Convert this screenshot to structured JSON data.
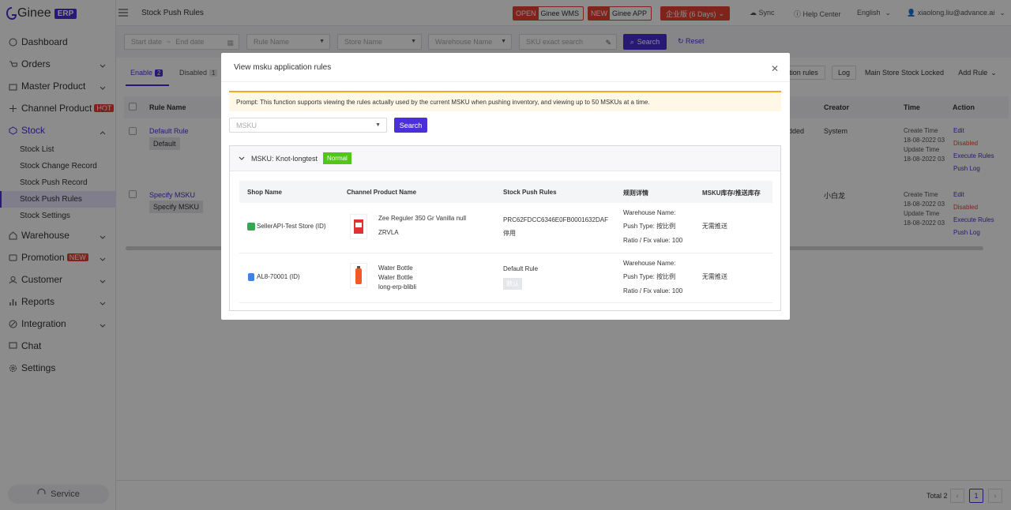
{
  "app": {
    "brand": "Ginee",
    "brand_tag": "ERP",
    "page_title": "Stock Push Rules"
  },
  "sidebar": {
    "items": [
      {
        "label": "Dashboard",
        "icon": "dashboard-icon"
      },
      {
        "label": "Orders",
        "icon": "cart-icon"
      },
      {
        "label": "Master Product",
        "icon": "bag-icon"
      },
      {
        "label": "Channel Product",
        "icon": "channel-icon",
        "badge": "HOT"
      },
      {
        "label": "Stock",
        "icon": "stock-icon"
      },
      {
        "label": "Warehouse",
        "icon": "warehouse-icon"
      },
      {
        "label": "Promotion",
        "icon": "promotion-icon",
        "badge": "NEW"
      },
      {
        "label": "Customer",
        "icon": "customer-icon"
      },
      {
        "label": "Reports",
        "icon": "reports-icon"
      },
      {
        "label": "Integration",
        "icon": "integration-icon"
      },
      {
        "label": "Chat",
        "icon": "chat-icon"
      },
      {
        "label": "Settings",
        "icon": "settings-icon"
      }
    ],
    "stock_sub": [
      "Stock List",
      "Stock Change Record",
      "Stock Push Record",
      "Stock Push Rules",
      "Stock Settings"
    ],
    "service": "Service"
  },
  "topbar": {
    "wms_tag": "OPEN",
    "wms_label": "Ginee WMS",
    "app_tag": "NEW",
    "app_label": "Ginee APP",
    "vip_label": "企业版 (6 Days)",
    "sync": "Sync",
    "help": "Help Center",
    "lang": "English",
    "user": "xiaolong.liu@advance.ai"
  },
  "filters": {
    "start_date": "Start date",
    "end_date": "End date",
    "rule_name": "Rule Name",
    "store_name": "Store Name",
    "warehouse_name": "Warehouse Name",
    "sku_search": "SKU exact search",
    "search": "Search",
    "reset": "Reset"
  },
  "tabs": {
    "enable": "Enable",
    "enable_count": "2",
    "disabled": "Disabled",
    "disabled_count": "1"
  },
  "actions": {
    "app_rules": "ation rules",
    "log": "Log",
    "main_store": "Main Store Stock Locked",
    "add_rule": "Add Rule"
  },
  "table": {
    "headers": {
      "rule_name": "Rule Name",
      "creator": "Creator",
      "time": "Time",
      "action": "Action"
    },
    "rows": [
      {
        "name": "Default Rule",
        "tag": "Default",
        "partial": "dded",
        "creator": "System",
        "create_label": "Create Time",
        "create": "18-08-2022 03",
        "update_label": "Update Time",
        "update": "18-08-2022 03",
        "actions": [
          "Edit",
          "Disabled",
          "Execute Rules",
          "Push Log"
        ]
      },
      {
        "name": "Specify MSKU",
        "tag": "Specify MSKU",
        "partial": "",
        "creator": "小白龙",
        "create_label": "Create Time",
        "create": "18-08-2022 03",
        "update_label": "Update Time",
        "update": "18-08-2022 03",
        "actions": [
          "Edit",
          "Disabled",
          "Execute Rules",
          "Push Log"
        ]
      }
    ]
  },
  "pager": {
    "total": "Total 2",
    "page": "1"
  },
  "modal": {
    "title": "View msku application rules",
    "prompt": "Prompt: This function supports viewing the rules actually used by the current MSKU when pushing inventory, and viewing up to 50 MSKUs at a time.",
    "msku_placeholder": "MSKU",
    "search": "Search",
    "panel_title": "MSKU: Knot-longtest",
    "panel_tag": "Normal",
    "headers": {
      "shop": "Shop Name",
      "product": "Channel Product Name",
      "rules": "Stock Push Rules",
      "detail": "规则详情",
      "stock": "MSKU库存/推送库存"
    },
    "rows": [
      {
        "shop": "SellerAPI-Test Store (ID)",
        "product1": "Zee Reguler 350 Gr Vanilla null",
        "product2": "ZRVLA",
        "product3": "",
        "rule1": "PRC62FDCC6346E0FB0001632DAF",
        "rule2": "停用",
        "wh": "Warehouse Name:",
        "push": "Push Type: 按比例",
        "ratio": "Ratio / Fix value: 100",
        "stock": "无需推送"
      },
      {
        "shop": "AL8-70001 (ID)",
        "product1": "Water Bottle",
        "product2": "Water Bottle",
        "product3": "long-erp-blibli",
        "rule1": "Default Rule",
        "rule2": "默认",
        "wh": "Warehouse Name:",
        "push": "Push Type: 按比例",
        "ratio": "Ratio / Fix value: 100",
        "stock": "无需推送"
      }
    ]
  }
}
